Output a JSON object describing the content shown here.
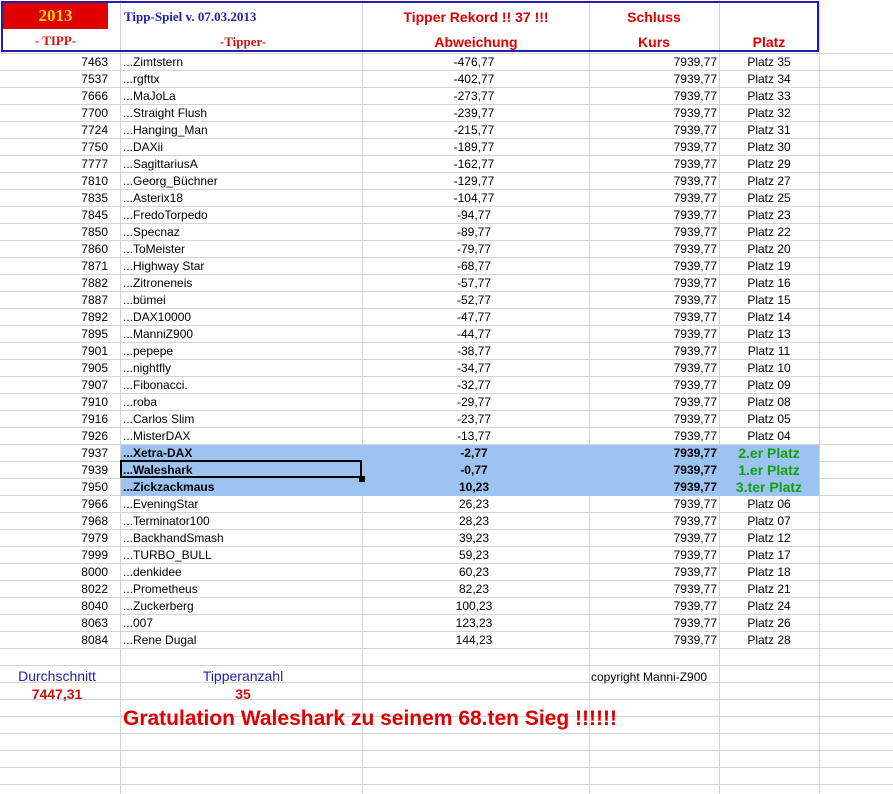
{
  "header": {
    "year": "2013",
    "tipp_label": "- TIPP-",
    "title": "Tipp-Spiel v. 07.03.2013",
    "tipper_label": "-Tipper-",
    "record": "Tipper Rekord !!  37  !!!",
    "abweichung_label": "Abweichung",
    "schluss_label": "Schluss",
    "kurs_label": "Kurs",
    "platz_label": "Platz"
  },
  "rows": [
    {
      "tipp": "7463",
      "name": "...Zimtstern",
      "abw": "-476,77",
      "kurs": "7939,77",
      "platz": "Platz 35"
    },
    {
      "tipp": "7537",
      "name": "...rgfttx",
      "abw": "-402,77",
      "kurs": "7939,77",
      "platz": "Platz 34"
    },
    {
      "tipp": "7666",
      "name": "...MaJoLa",
      "abw": "-273,77",
      "kurs": "7939,77",
      "platz": "Platz 33"
    },
    {
      "tipp": "7700",
      "name": "...Straight Flush",
      "abw": "-239,77",
      "kurs": "7939,77",
      "platz": "Platz 32"
    },
    {
      "tipp": "7724",
      "name": "...Hanging_Man",
      "abw": "-215,77",
      "kurs": "7939,77",
      "platz": "Platz 31"
    },
    {
      "tipp": "7750",
      "name": "...DAXii",
      "abw": "-189,77",
      "kurs": "7939,77",
      "platz": "Platz 30"
    },
    {
      "tipp": "7777",
      "name": "...SagittariusA",
      "abw": "-162,77",
      "kurs": "7939,77",
      "platz": "Platz 29"
    },
    {
      "tipp": "7810",
      "name": "...Georg_Büchner",
      "abw": "-129,77",
      "kurs": "7939,77",
      "platz": "Platz 27"
    },
    {
      "tipp": "7835",
      "name": "...Asterix18",
      "abw": "-104,77",
      "kurs": "7939,77",
      "platz": "Platz 25"
    },
    {
      "tipp": "7845",
      "name": "...FredoTorpedo",
      "abw": "-94,77",
      "kurs": "7939,77",
      "platz": "Platz 23"
    },
    {
      "tipp": "7850",
      "name": "...Specnaz",
      "abw": "-89,77",
      "kurs": "7939,77",
      "platz": "Platz 22"
    },
    {
      "tipp": "7860",
      "name": "...ToMeister",
      "abw": "-79,77",
      "kurs": "7939,77",
      "platz": "Platz 20"
    },
    {
      "tipp": "7871",
      "name": "...Highway Star",
      "abw": "-68,77",
      "kurs": "7939,77",
      "platz": "Platz 19"
    },
    {
      "tipp": "7882",
      "name": "...Zitroneneis",
      "abw": "-57,77",
      "kurs": "7939,77",
      "platz": "Platz 16"
    },
    {
      "tipp": "7887",
      "name": "...bümei",
      "abw": "-52,77",
      "kurs": "7939,77",
      "platz": "Platz 15"
    },
    {
      "tipp": "7892",
      "name": "...DAX10000",
      "abw": "-47,77",
      "kurs": "7939,77",
      "platz": "Platz 14"
    },
    {
      "tipp": "7895",
      "name": "...ManniZ900",
      "abw": "-44,77",
      "kurs": "7939,77",
      "platz": "Platz 13"
    },
    {
      "tipp": "7901",
      "name": "...pepepe",
      "abw": "-38,77",
      "kurs": "7939,77",
      "platz": "Platz 11"
    },
    {
      "tipp": "7905",
      "name": "...nightfly",
      "abw": "-34,77",
      "kurs": "7939,77",
      "platz": "Platz 10"
    },
    {
      "tipp": "7907",
      "name": "...Fibonacci.",
      "abw": "-32,77",
      "kurs": "7939,77",
      "platz": "Platz 09"
    },
    {
      "tipp": "7910",
      "name": "...roba",
      "abw": "-29,77",
      "kurs": "7939,77",
      "platz": "Platz 08"
    },
    {
      "tipp": "7916",
      "name": "...Carlos Slim",
      "abw": "-23,77",
      "kurs": "7939,77",
      "platz": "Platz 05"
    },
    {
      "tipp": "7926",
      "name": "...MisterDAX",
      "abw": "-13,77",
      "kurs": "7939,77",
      "platz": "Platz 04"
    },
    {
      "tipp": "7937",
      "name": "...Xetra-DAX",
      "abw": "-2,77",
      "kurs": "7939,77",
      "platz": "2.er Platz",
      "winner": true
    },
    {
      "tipp": "7939",
      "name": "...Waleshark",
      "abw": "-0,77",
      "kurs": "7939,77",
      "platz": "1.er Platz",
      "winner": true
    },
    {
      "tipp": "7950",
      "name": "...Zickzackmaus",
      "abw": "10,23",
      "kurs": "7939,77",
      "platz": "3.ter Platz",
      "winner": true
    },
    {
      "tipp": "7966",
      "name": "...EveningStar",
      "abw": "26,23",
      "kurs": "7939,77",
      "platz": "Platz 06"
    },
    {
      "tipp": "7968",
      "name": "...Terminator100",
      "abw": "28,23",
      "kurs": "7939,77",
      "platz": "Platz 07"
    },
    {
      "tipp": "7979",
      "name": "...BackhandSmash",
      "abw": "39,23",
      "kurs": "7939,77",
      "platz": "Platz 12"
    },
    {
      "tipp": "7999",
      "name": "...TURBO_BULL",
      "abw": "59,23",
      "kurs": "7939,77",
      "platz": "Platz 17"
    },
    {
      "tipp": "8000",
      "name": "...denkidee",
      "abw": "60,23",
      "kurs": "7939,77",
      "platz": "Platz 18"
    },
    {
      "tipp": "8022",
      "name": "...Prometheus",
      "abw": "82,23",
      "kurs": "7939,77",
      "platz": "Platz 21"
    },
    {
      "tipp": "8040",
      "name": "...Zuckerberg",
      "abw": "100,23",
      "kurs": "7939,77",
      "platz": "Platz 24"
    },
    {
      "tipp": "8063",
      "name": "...007",
      "abw": "123,23",
      "kurs": "7939,77",
      "platz": "Platz 26"
    },
    {
      "tipp": "8084",
      "name": "...Rene Dugal",
      "abw": "144,23",
      "kurs": "7939,77",
      "platz": "Platz 28"
    }
  ],
  "footer": {
    "avg_label": "Durchschnitt",
    "avg_value": "7447,31",
    "count_label": "Tipperanzahl",
    "count_value": "35",
    "copyright": "copyright Manni-Z900",
    "congrats": "Gratulation Waleshark  zu seinem 68.ten Sieg !!!!!!"
  },
  "colors": {
    "header_border": "#1f1fb0",
    "year_bg": "#e00000",
    "year_text": "#ffd400",
    "red_text": "#e00000",
    "highlight_bg": "#9dc3f0",
    "winner_text": "#14a014"
  }
}
